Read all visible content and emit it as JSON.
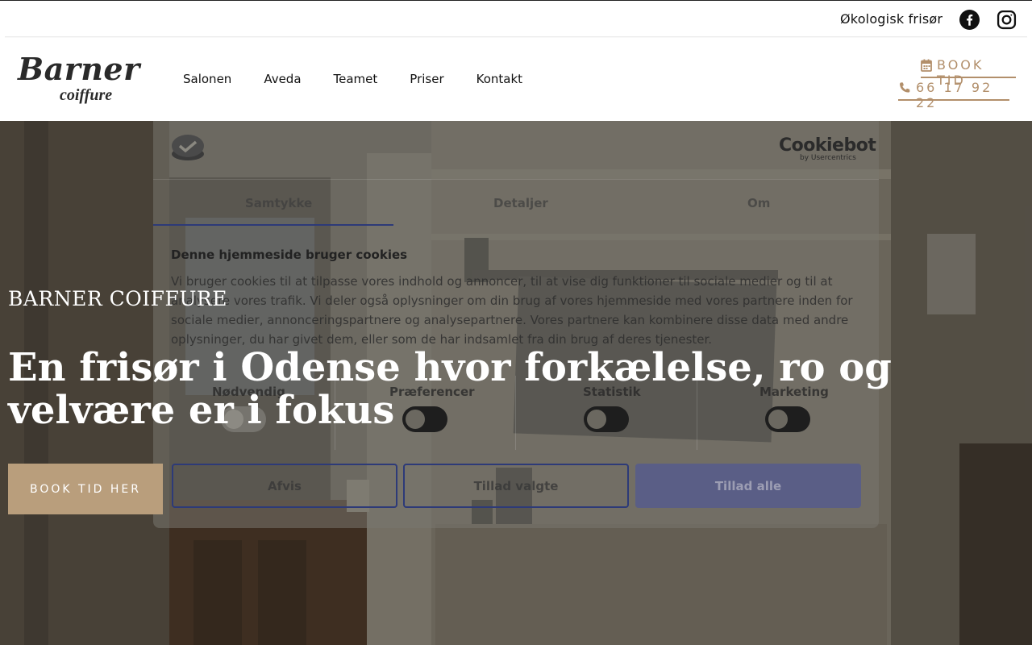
{
  "topbar": {
    "eco_link": "Økologisk frisør",
    "social": [
      "facebook-icon",
      "instagram-icon"
    ]
  },
  "header": {
    "logo_main": "Barner",
    "logo_sub": "coiffure",
    "nav": [
      "Salonen",
      "Aveda",
      "Teamet",
      "Priser",
      "Kontakt"
    ],
    "book_label": "BOOK TID",
    "phone_label": "66 17 92 22"
  },
  "cookie": {
    "brand": "Cookiebot",
    "brand_sub": "by Usercentrics",
    "tabs": [
      "Samtykke",
      "Detaljer",
      "Om"
    ],
    "active_tab": "Samtykke",
    "heading": "Denne hjemmeside bruger cookies",
    "text": "Vi bruger cookies til at tilpasse vores indhold og annoncer, til at vise dig funktioner til sociale medier og til at analysere vores trafik. Vi deler også oplysninger om din brug af vores hjemmeside med vores partnere inden for sociale medier, annonceringspartnere og analysepartnere. Vores partnere kan kombinere disse data med andre oplysninger, du har givet dem, eller som de har indsamlet fra din brug af deres tjenester.",
    "categories": [
      "Nødvendig",
      "Præferencer",
      "Statistik",
      "Marketing"
    ],
    "buttons": {
      "reject": "Afvis",
      "allow_selected": "Tillad valgte",
      "allow_all": "Tillad alle"
    }
  },
  "hero": {
    "kicker": "BARNER COIFFURE",
    "title": "En frisør i Odense hvor forkælelse, ro og velvære er i fokus",
    "button": "BOOK TID HER"
  },
  "colors": {
    "accent": "#b28f6b",
    "hero_button": "#b99e7c",
    "cookie_blue": "#2d3a78"
  }
}
